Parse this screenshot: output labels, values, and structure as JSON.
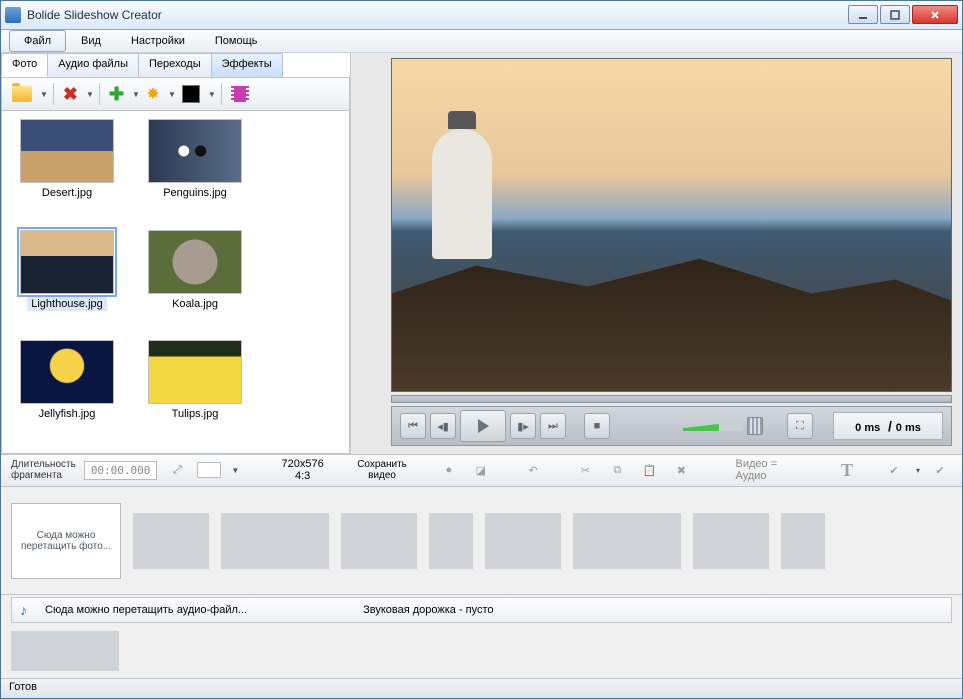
{
  "window": {
    "title": "Bolide Slideshow Creator"
  },
  "menu": {
    "items": [
      "Файл",
      "Вид",
      "Настройки",
      "Помощь"
    ],
    "active_index": 0
  },
  "tabs": {
    "items": [
      "Фото",
      "Аудио файлы",
      "Переходы",
      "Эффекты"
    ],
    "active_index": 0,
    "hover_index": 3
  },
  "thumbs": [
    {
      "name": "Desert.jpg",
      "cls": "th-desert"
    },
    {
      "name": "Penguins.jpg",
      "cls": "th-peng"
    },
    {
      "name": "Lighthouse.jpg",
      "cls": "th-lh",
      "selected": true
    },
    {
      "name": "Koala.jpg",
      "cls": "th-koala"
    },
    {
      "name": "Jellyfish.jpg",
      "cls": "th-jelly"
    },
    {
      "name": "Tulips.jpg",
      "cls": "th-tulip"
    }
  ],
  "player": {
    "time_current": "0 ms",
    "time_total": "0 ms"
  },
  "midctrl": {
    "duration_label": "Длительность\nфрагмента",
    "duration_value": "00:00.000",
    "resolution": "720x576",
    "aspect": "4:3",
    "save_label": "Сохранить\nвидео",
    "video_eq_audio": "Видео = Аудио"
  },
  "storyboard": {
    "drop_hint": "Сюда можно перетащить фото...",
    "audio_hint": "Сюда можно перетащить аудио-файл...",
    "audio_empty": "Звуковая дорожка - пусто"
  },
  "status": {
    "text": "Готов"
  }
}
